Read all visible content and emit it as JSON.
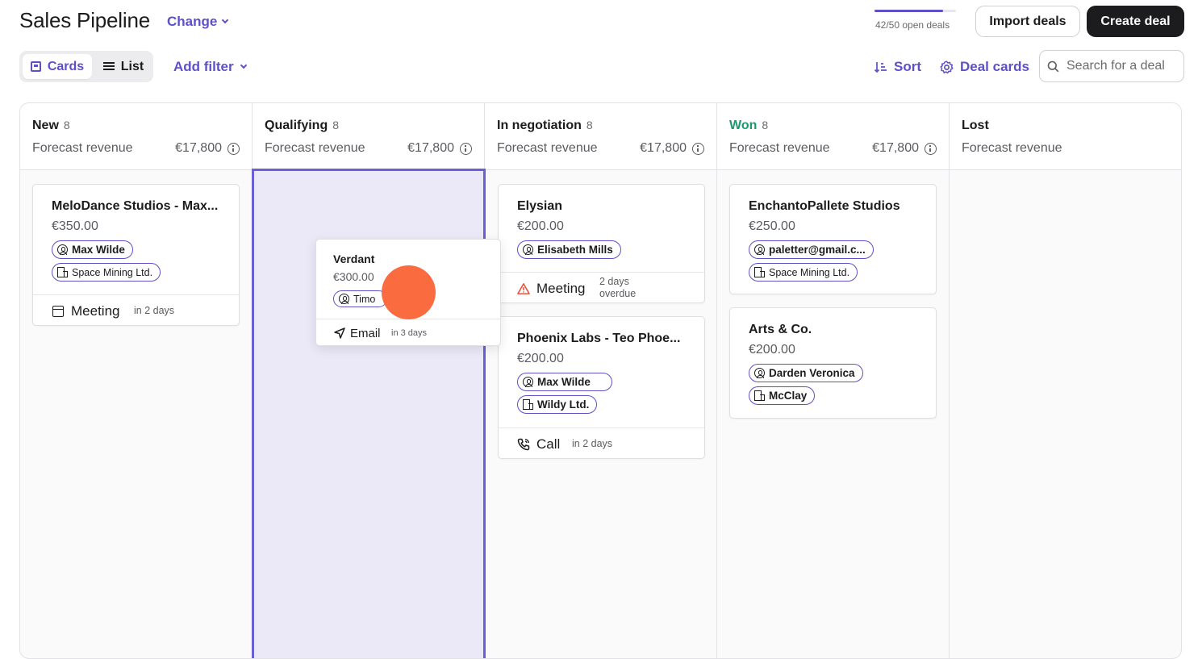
{
  "header": {
    "title": "Sales Pipeline",
    "change_label": "Change",
    "open_deals_text": "42/50 open deals",
    "open_deals_fraction": 0.84,
    "import_label": "Import deals",
    "create_label": "Create deal"
  },
  "toolbar": {
    "view_cards_label": "Cards",
    "view_list_label": "List",
    "active_view": "Cards",
    "add_filter_label": "Add filter",
    "sort_label": "Sort",
    "deal_cards_label": "Deal cards",
    "search_placeholder": "Search for a deal"
  },
  "colors": {
    "accent": "#5d50c9",
    "won": "#1a9a6c",
    "warning": "#e8523b",
    "drag_cursor": "#fa6b40",
    "drop_zone": "#ebe8f7"
  },
  "columns": [
    {
      "name": "New",
      "count": "8",
      "forecast_label": "Forecast revenue",
      "amount": "€17,800"
    },
    {
      "name": "Qualifying",
      "count": "8",
      "forecast_label": "Forecast revenue",
      "amount": "€17,800"
    },
    {
      "name": "In negotiation",
      "count": "8",
      "forecast_label": "Forecast revenue",
      "amount": "€17,800"
    },
    {
      "name": "Won",
      "count": "8",
      "forecast_label": "Forecast revenue",
      "amount": "€17,800"
    },
    {
      "name": "Lost",
      "forecast_label": "Forecast revenue"
    }
  ],
  "cards": {
    "melodance": {
      "title": "MeloDance Studios - Max...",
      "amount": "€350.00",
      "contact": "Max Wilde",
      "company": "Space Mining Ltd.",
      "activity": "Meeting",
      "activity_icon": "calendar-icon",
      "when": "in 2 days"
    },
    "verdant": {
      "title": "Verdant",
      "amount": "€300.00",
      "contact": "Timo",
      "activity": "Email",
      "activity_icon": "send-icon",
      "when": "in 3 days"
    },
    "elysian": {
      "title": "Elysian",
      "amount": "€200.00",
      "contact": "Elisabeth Mills",
      "activity": "Meeting",
      "activity_icon": "warning-icon",
      "when_line1": "2 days",
      "when_line2": "overdue"
    },
    "phoenix": {
      "title": "Phoenix Labs - Teo Phoe...",
      "amount": "€200.00",
      "contact": "Max Wilde",
      "company": "Wildy Ltd.",
      "activity": "Call",
      "activity_icon": "phone-icon",
      "when": "in 2 days"
    },
    "enchanto": {
      "title": "EnchantoPallete Studios",
      "amount": "€250.00",
      "contact": "paletter@gmail.c...",
      "company": "Space Mining Ltd."
    },
    "arts": {
      "title": "Arts & Co.",
      "amount": "€200.00",
      "contact": "Darden Veronica",
      "company": "McClay"
    }
  }
}
